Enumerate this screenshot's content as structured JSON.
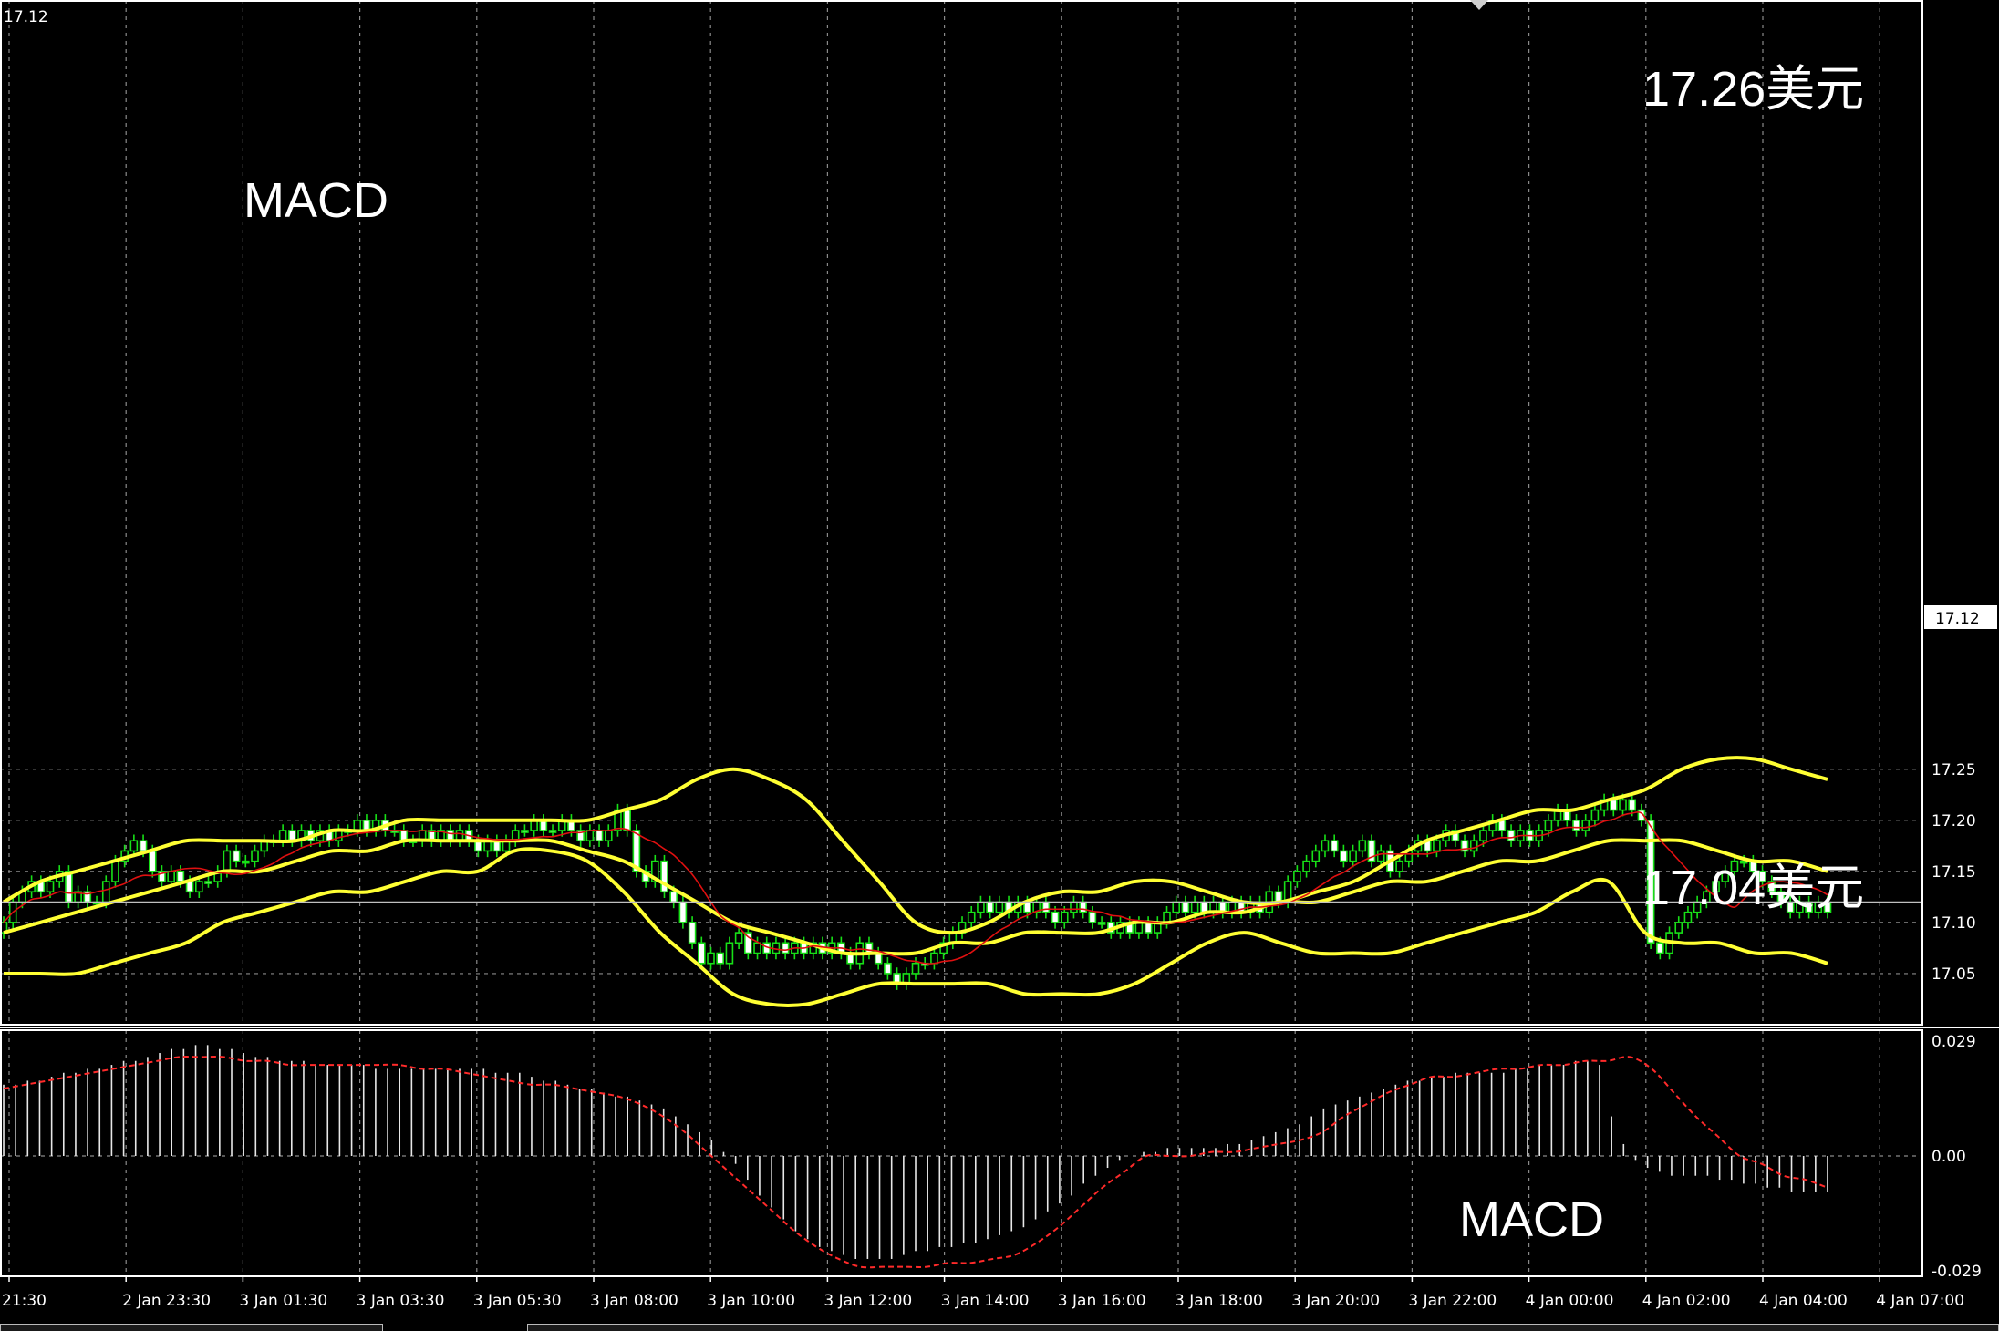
{
  "chart_data": [
    {
      "type": "candlestick",
      "instrument_price_label": "17.12",
      "annotations": [
        "MACD",
        "17.26美元",
        "17.04美元"
      ],
      "current_price": 17.12,
      "current_price_label": "17.12",
      "y_ticks": [
        "17.25",
        "17.20",
        "17.15",
        "17.10",
        "17.05"
      ],
      "y_tick_values": [
        17.25,
        17.2,
        17.15,
        17.1,
        17.05
      ],
      "ylim": [
        17.0,
        17.3
      ],
      "x_ticks": [
        "21:30",
        "2 Jan 23:30",
        "3 Jan 01:30",
        "3 Jan 03:30",
        "3 Jan 05:30",
        "3 Jan 08:00",
        "3 Jan 10:00",
        "3 Jan 12:00",
        "3 Jan 14:00",
        "3 Jan 16:00",
        "3 Jan 18:00",
        "3 Jan 20:00",
        "3 Jan 22:00",
        "4 Jan 00:00",
        "4 Jan 02:00",
        "4 Jan 04:00",
        "4 Jan 07:00"
      ],
      "candles_close": [
        17.1,
        17.12,
        17.13,
        17.14,
        17.13,
        17.14,
        17.15,
        17.12,
        17.13,
        17.12,
        17.12,
        17.14,
        17.16,
        17.17,
        17.18,
        17.17,
        17.15,
        17.14,
        17.15,
        17.14,
        17.13,
        17.14,
        17.14,
        17.15,
        17.17,
        17.16,
        17.16,
        17.17,
        17.18,
        17.18,
        17.19,
        17.18,
        17.19,
        17.18,
        17.19,
        17.18,
        17.19,
        17.19,
        17.2,
        17.19,
        17.2,
        17.19,
        17.19,
        17.18,
        17.18,
        17.19,
        17.18,
        17.19,
        17.18,
        17.19,
        17.18,
        17.17,
        17.18,
        17.17,
        17.18,
        17.19,
        17.19,
        17.2,
        17.19,
        17.19,
        17.2,
        17.19,
        17.18,
        17.19,
        17.18,
        17.19,
        17.21,
        17.19,
        17.15,
        17.14,
        17.16,
        17.13,
        17.12,
        17.1,
        17.08,
        17.06,
        17.07,
        17.06,
        17.08,
        17.09,
        17.07,
        17.08,
        17.07,
        17.08,
        17.07,
        17.08,
        17.07,
        17.08,
        17.07,
        17.08,
        17.07,
        17.06,
        17.08,
        17.07,
        17.06,
        17.05,
        17.04,
        17.05,
        17.06,
        17.06,
        17.07,
        17.08,
        17.09,
        17.1,
        17.11,
        17.12,
        17.11,
        17.12,
        17.11,
        17.12,
        17.11,
        17.12,
        17.11,
        17.1,
        17.11,
        17.12,
        17.11,
        17.1,
        17.1,
        17.09,
        17.1,
        17.09,
        17.1,
        17.09,
        17.1,
        17.11,
        17.12,
        17.11,
        17.12,
        17.11,
        17.12,
        17.11,
        17.12,
        17.11,
        17.12,
        17.11,
        17.13,
        17.12,
        17.14,
        17.15,
        17.16,
        17.17,
        17.18,
        17.17,
        17.16,
        17.17,
        17.18,
        17.16,
        17.17,
        17.15,
        17.16,
        17.17,
        17.18,
        17.17,
        17.18,
        17.19,
        17.18,
        17.17,
        17.18,
        17.19,
        17.2,
        17.19,
        17.18,
        17.19,
        17.18,
        17.19,
        17.2,
        17.21,
        17.2,
        17.19,
        17.2,
        17.21,
        17.22,
        17.21,
        17.22,
        17.21,
        17.2,
        17.08,
        17.07,
        17.09,
        17.1,
        17.11,
        17.12,
        17.13,
        17.14,
        17.15,
        17.16,
        17.16,
        17.15,
        17.14,
        17.13,
        17.12,
        17.11,
        17.12,
        17.11,
        17.12,
        17.11
      ],
      "series": [
        {
          "name": "",
          "values": [
            17.12,
            17.14,
            17.15,
            17.16,
            17.17,
            17.18,
            17.18,
            17.18,
            17.18,
            17.19,
            17.19,
            17.2,
            17.2,
            17.2,
            17.2,
            17.2,
            17.2,
            17.21,
            17.22,
            17.24,
            17.25,
            17.24,
            17.22,
            17.18,
            17.14,
            17.1,
            17.09,
            17.1,
            17.12,
            17.13,
            17.13,
            17.14,
            17.14,
            17.13,
            17.12,
            17.12,
            17.13,
            17.14,
            17.16,
            17.18,
            17.19,
            17.2,
            17.21,
            17.21,
            17.22,
            17.23,
            17.25,
            17.26,
            17.26,
            17.25,
            17.24
          ]
        },
        {
          "name": "",
          "values": [
            17.09,
            17.1,
            17.11,
            17.12,
            17.13,
            17.14,
            17.15,
            17.15,
            17.16,
            17.17,
            17.17,
            17.18,
            17.18,
            17.18,
            17.18,
            17.18,
            17.17,
            17.16,
            17.14,
            17.12,
            17.1,
            17.09,
            17.08,
            17.07,
            17.07,
            17.07,
            17.08,
            17.08,
            17.09,
            17.09,
            17.09,
            17.1,
            17.1,
            17.11,
            17.11,
            17.12,
            17.12,
            17.13,
            17.14,
            17.14,
            17.15,
            17.16,
            17.16,
            17.17,
            17.18,
            17.18,
            17.18,
            17.17,
            17.16,
            17.16,
            17.15
          ]
        },
        {
          "name": "",
          "values": [
            17.05,
            17.05,
            17.05,
            17.06,
            17.07,
            17.08,
            17.1,
            17.11,
            17.12,
            17.13,
            17.13,
            17.14,
            17.15,
            17.15,
            17.17,
            17.17,
            17.16,
            17.13,
            17.09,
            17.06,
            17.03,
            17.02,
            17.02,
            17.03,
            17.04,
            17.04,
            17.04,
            17.04,
            17.03,
            17.03,
            17.03,
            17.04,
            17.06,
            17.08,
            17.09,
            17.08,
            17.07,
            17.07,
            17.07,
            17.08,
            17.09,
            17.1,
            17.11,
            17.13,
            17.14,
            17.09,
            17.08,
            17.08,
            17.07,
            17.07,
            17.06
          ]
        }
      ]
    },
    {
      "type": "bar",
      "indicator": "MACD",
      "annotation": "MACD",
      "y_ticks": [
        "0.029",
        "0.00",
        "-0.029"
      ],
      "y_tick_values": [
        0.029,
        0.0,
        -0.029
      ],
      "ylim": [
        -0.031,
        0.031
      ],
      "values": [
        0.018,
        0.018,
        0.019,
        0.019,
        0.02,
        0.021,
        0.021,
        0.022,
        0.022,
        0.023,
        0.024,
        0.024,
        0.025,
        0.026,
        0.027,
        0.027,
        0.028,
        0.028,
        0.027,
        0.027,
        0.026,
        0.025,
        0.025,
        0.024,
        0.024,
        0.024,
        0.023,
        0.023,
        0.023,
        0.023,
        0.023,
        0.022,
        0.022,
        0.022,
        0.022,
        0.022,
        0.022,
        0.022,
        0.022,
        0.022,
        0.022,
        0.021,
        0.021,
        0.021,
        0.02,
        0.019,
        0.019,
        0.018,
        0.017,
        0.017,
        0.016,
        0.015,
        0.015,
        0.014,
        0.013,
        0.012,
        0.01,
        0.008,
        0.006,
        0.004,
        0.001,
        -0.002,
        -0.006,
        -0.01,
        -0.013,
        -0.016,
        -0.019,
        -0.021,
        -0.023,
        -0.024,
        -0.025,
        -0.026,
        -0.026,
        -0.026,
        -0.026,
        -0.025,
        -0.024,
        -0.024,
        -0.023,
        -0.023,
        -0.022,
        -0.022,
        -0.021,
        -0.02,
        -0.019,
        -0.018,
        -0.016,
        -0.014,
        -0.012,
        -0.01,
        -0.007,
        -0.005,
        -0.003,
        -0.001,
        0.0,
        0.001,
        0.001,
        0.002,
        0.002,
        0.002,
        0.002,
        0.002,
        0.003,
        0.003,
        0.004,
        0.005,
        0.006,
        0.007,
        0.008,
        0.01,
        0.012,
        0.013,
        0.014,
        0.015,
        0.016,
        0.017,
        0.018,
        0.019,
        0.019,
        0.02,
        0.02,
        0.021,
        0.021,
        0.021,
        0.021,
        0.021,
        0.022,
        0.022,
        0.023,
        0.023,
        0.023,
        0.024,
        0.024,
        0.023,
        0.01,
        0.003,
        -0.001,
        -0.003,
        -0.004,
        -0.005,
        -0.005,
        -0.005,
        -0.005,
        -0.006,
        -0.006,
        -0.007,
        -0.007,
        -0.008,
        -0.008,
        -0.009,
        -0.009,
        -0.009,
        -0.009
      ],
      "signal": [
        0.017,
        0.018,
        0.019,
        0.02,
        0.021,
        0.022,
        0.023,
        0.024,
        0.025,
        0.025,
        0.025,
        0.024,
        0.024,
        0.023,
        0.023,
        0.023,
        0.023,
        0.023,
        0.023,
        0.022,
        0.022,
        0.021,
        0.02,
        0.019,
        0.018,
        0.018,
        0.017,
        0.016,
        0.015,
        0.013,
        0.01,
        0.006,
        0.001,
        -0.004,
        -0.009,
        -0.014,
        -0.019,
        -0.023,
        -0.026,
        -0.028,
        -0.028,
        -0.028,
        -0.028,
        -0.027,
        -0.027,
        -0.026,
        -0.025,
        -0.022,
        -0.018,
        -0.013,
        -0.008,
        -0.004,
        0.0,
        0.0,
        0.0,
        0.001,
        0.001,
        0.002,
        0.003,
        0.004,
        0.006,
        0.01,
        0.013,
        0.016,
        0.018,
        0.02,
        0.02,
        0.021,
        0.022,
        0.022,
        0.023,
        0.023,
        0.024,
        0.024,
        0.025,
        0.022,
        0.016,
        0.01,
        0.005,
        0.0,
        -0.002,
        -0.005,
        -0.006,
        -0.008
      ]
    }
  ]
}
